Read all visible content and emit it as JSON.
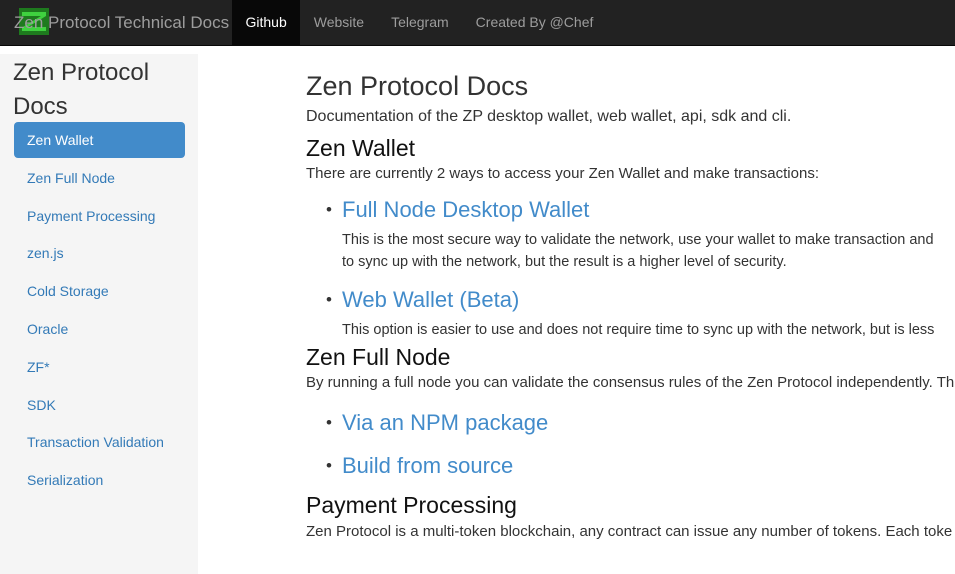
{
  "navbar": {
    "brand": "Zen Protocol Technical Docs",
    "logo_icon": "zen-logo-icon",
    "links": [
      {
        "label": "Github",
        "active": true
      },
      {
        "label": "Website",
        "active": false
      },
      {
        "label": "Telegram",
        "active": false
      },
      {
        "label": "Created By @Chef",
        "active": false
      }
    ]
  },
  "sidebar": {
    "title": "Zen Protocol Docs",
    "items": [
      {
        "label": "Zen Wallet"
      },
      {
        "label": "Zen Full Node"
      },
      {
        "label": "Payment Processing"
      },
      {
        "label": "zen.js"
      },
      {
        "label": "Cold Storage"
      },
      {
        "label": "Oracle"
      },
      {
        "label": "ZF*"
      },
      {
        "label": "SDK"
      },
      {
        "label": "Transaction Validation"
      },
      {
        "label": "Serialization"
      }
    ],
    "active_index": 0
  },
  "main": {
    "title": "Zen Protocol Docs",
    "intro": "Documentation of the ZP desktop wallet, web wallet, api, sdk and cli.",
    "wallet": {
      "heading": "Zen Wallet",
      "text": "There are currently 2 ways to access your Zen Wallet and make transactions:",
      "options": [
        {
          "title": "Full Node Desktop Wallet",
          "line1": "This is the most secure way to validate the network, use your wallet to make transaction and",
          "line2": "to sync up with the network, but the result is a higher level of security."
        },
        {
          "title": "Web Wallet (Beta)",
          "line1": "This option is easier to use and does not require time to sync up with the network, but is less"
        }
      ]
    },
    "full_node": {
      "heading": "Zen Full Node",
      "text": "By running a full node you can validate the consensus rules of the Zen Protocol independently. Th",
      "links": [
        "Via an NPM package",
        "Build from source"
      ]
    },
    "payment": {
      "heading": "Payment Processing",
      "text": "Zen Protocol is a multi-token blockchain, any contract can issue any number of tokens. Each toke"
    }
  },
  "colors": {
    "navbar_bg": "#222222",
    "link": "#428bca",
    "active_item": "#428bca",
    "sidebar_bg": "#f5f5f5"
  }
}
